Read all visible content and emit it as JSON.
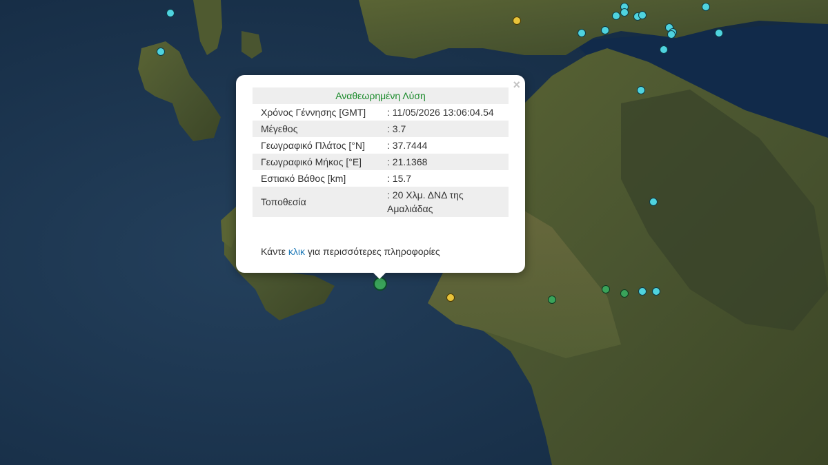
{
  "popup": {
    "title": "Αναθεωρημένη Λύση",
    "close_icon": "×",
    "rows": [
      {
        "label": "Χρόνος Γέννησης [GMT]",
        "value": ": 11/05/2026 13:06:04.54"
      },
      {
        "label": "Μέγεθος",
        "value": ": 3.7"
      },
      {
        "label": "Γεωγραφικό Πλάτος [°N]",
        "value": ": 37.7444"
      },
      {
        "label": "Γεωγραφικό Μήκος [°E]",
        "value": ": 21.1368"
      },
      {
        "label": "Εστιακό Βάθος [km]",
        "value": ": 15.7"
      },
      {
        "label": "Τοποθεσία",
        "value": ": 20 Χλμ. ΔΝΔ της Αμαλιάδας"
      }
    ],
    "footer_prefix": "Κάντε ",
    "footer_link": "κλικ",
    "footer_suffix": " για περισσότερες πληροφορίες"
  },
  "colors": {
    "sea": "#1d3550",
    "land": "#4d5a30",
    "marker_cyan": "#4fd3df",
    "marker_green": "#3aa35a",
    "marker_yellow": "#e8c33a",
    "title_green": "#1a8a2a",
    "link_blue": "#1f7ab8"
  },
  "markers": {
    "count_visible": 26
  }
}
